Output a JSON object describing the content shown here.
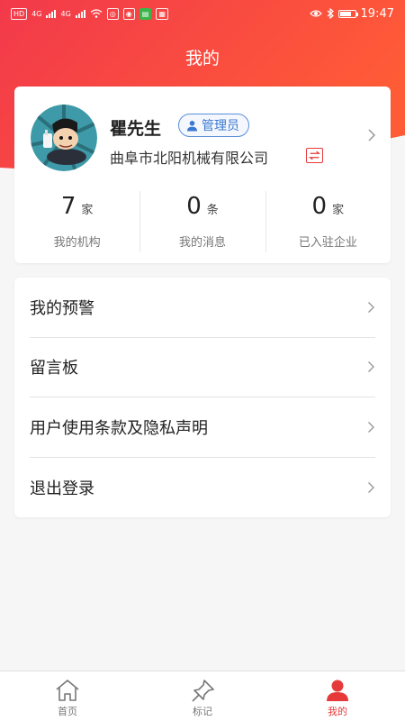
{
  "status_bar": {
    "left_chips": [
      "HD",
      "4G",
      "4G"
    ],
    "time": "19:47"
  },
  "header": {
    "title": "我的"
  },
  "profile": {
    "name": "瞿先生",
    "role_badge": "管理员",
    "company": "曲阜市北阳机械有限公司",
    "stats": [
      {
        "value": "7",
        "unit": "家",
        "label": "我的机构"
      },
      {
        "value": "0",
        "unit": "条",
        "label": "我的消息"
      },
      {
        "value": "0",
        "unit": "家",
        "label": "已入驻企业"
      }
    ]
  },
  "menu": {
    "items": [
      {
        "label": "我的预警"
      },
      {
        "label": "留言板"
      },
      {
        "label": "用户使用条款及隐私声明"
      },
      {
        "label": "退出登录"
      }
    ]
  },
  "tabbar": {
    "tabs": [
      {
        "label": "首页",
        "icon": "home-icon"
      },
      {
        "label": "标记",
        "icon": "pin-icon"
      },
      {
        "label": "我的",
        "icon": "user-icon",
        "active": true
      }
    ]
  },
  "colors": {
    "header_gradient_start": "#f23a4c",
    "header_gradient_end": "#ff5a36",
    "accent": "#e63a3a",
    "badge_blue": "#3b78d0"
  }
}
